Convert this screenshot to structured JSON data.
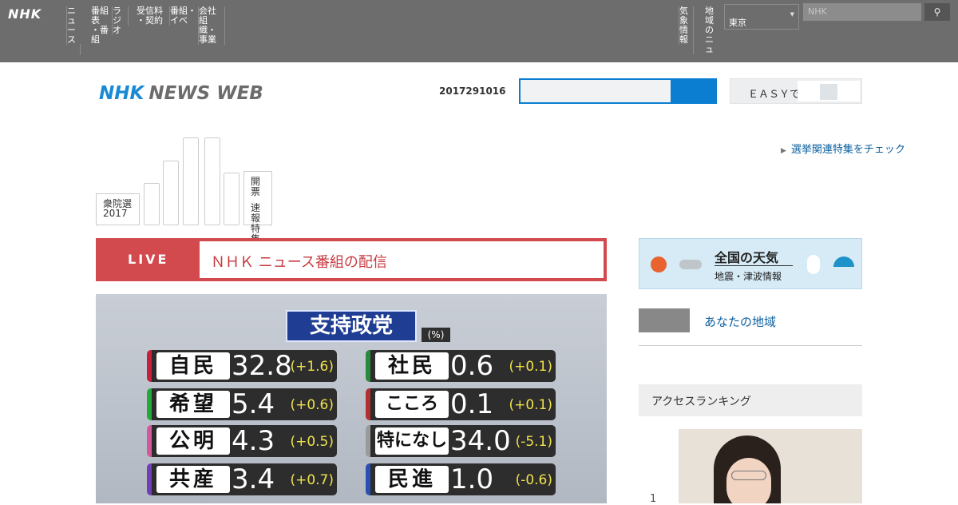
{
  "global_bar": {
    "logo": "NHK",
    "nav": [
      "ニュ\nース",
      "番組表\n・番組",
      "ラ\nジオ",
      "受信料\n・契約",
      "番組・\nイベ",
      "会社\n組織・\n事業"
    ],
    "right_nav": [
      "気象\n情報",
      "地域の\nニュ"
    ],
    "region_select": "東京",
    "search_placeholder": "NHK",
    "search_icon": "search-icon"
  },
  "header": {
    "logo_nhk": "NHK",
    "logo_newsweb": "NEWS WEB",
    "date": "2017291016",
    "toggle_label": "ＥＡＳＹで"
  },
  "election": {
    "label_line1": "衆院選",
    "label_line2": "2017",
    "bar_levels": [
      0.48,
      0.74,
      1.0,
      1.0,
      0.6
    ],
    "side_label_1": "開票",
    "side_label_2": "速報\n特集",
    "link": "選挙関連特集をチェック"
  },
  "live": {
    "tag": "LIVE",
    "title": "ＮＨＫ ニュース番組の配信"
  },
  "main_image": {
    "banner": "支持政党",
    "unit": "(%)",
    "parties": [
      {
        "name": "自民",
        "value": "32.8",
        "change": "(+1.6)",
        "color": "#c8203a"
      },
      {
        "name": "希望",
        "value": "5.4",
        "change": "(+0.6)",
        "color": "#22a93a"
      },
      {
        "name": "公明",
        "value": "4.3",
        "change": "(+0.5)",
        "color": "#d35a9a"
      },
      {
        "name": "共産",
        "value": "3.4",
        "change": "(+0.7)",
        "color": "#6f3fb5"
      },
      {
        "name": "社民",
        "value": "0.6",
        "change": "(+0.1)",
        "color": "#2a8a3b"
      },
      {
        "name": "こころ",
        "value": "0.1",
        "change": "(+0.1)",
        "color": "#b23030"
      },
      {
        "name": "特になし",
        "value": "34.0",
        "change": "(-5.1)",
        "color": "#9a9a9a"
      },
      {
        "name": "民進",
        "value": "1.0",
        "change": "(-0.6)",
        "color": "#2a4fb0"
      }
    ]
  },
  "sidebar": {
    "weather_title": "全国の天気",
    "weather_sub": "地震・津波情報",
    "pill_link": "あなたの地域",
    "ranking_title": "アクセスランキング",
    "rank1_num": "1"
  }
}
